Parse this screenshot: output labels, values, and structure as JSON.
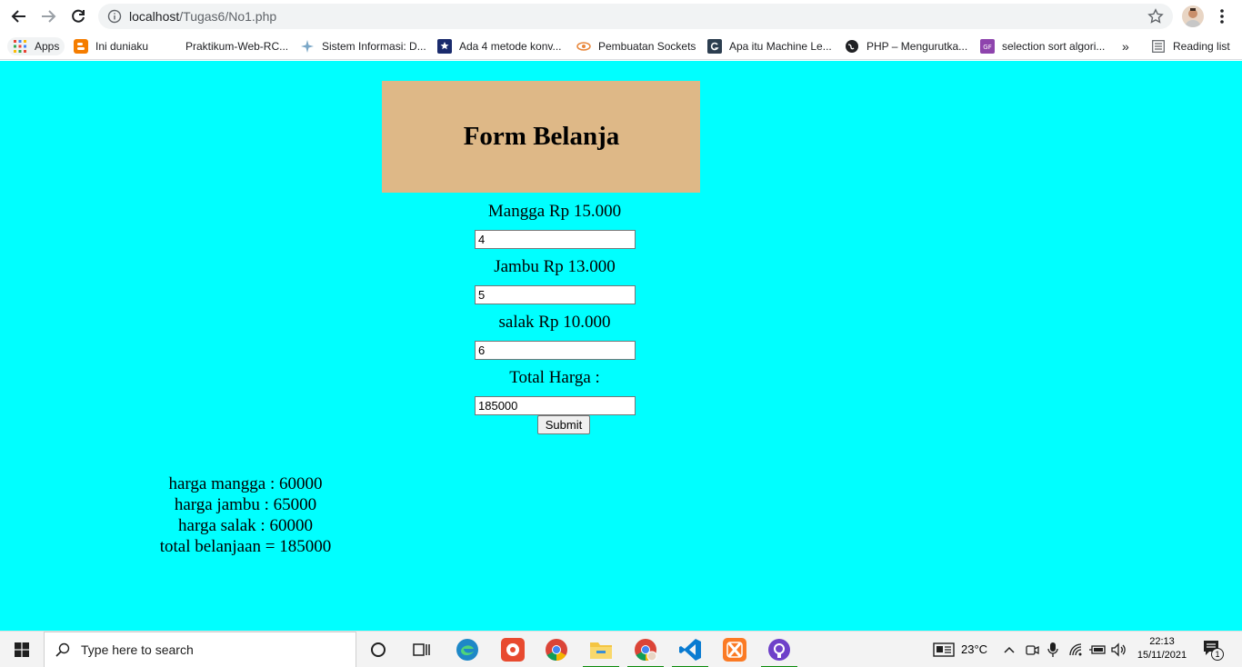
{
  "browser": {
    "url_host": "localhost",
    "url_path": "/Tugas6/No1.php",
    "bookmarks": [
      {
        "label": "Apps"
      },
      {
        "label": "Ini duniaku"
      },
      {
        "label": "Praktikum-Web-RC..."
      },
      {
        "label": "Sistem Informasi: D..."
      },
      {
        "label": "Ada 4 metode konv..."
      },
      {
        "label": "Pembuatan Sockets"
      },
      {
        "label": "Apa itu Machine Le..."
      },
      {
        "label": "PHP – Mengurutka..."
      },
      {
        "label": "selection sort algori..."
      }
    ],
    "more_label": "»",
    "reading_list": "Reading list"
  },
  "form": {
    "title": "Form Belanja",
    "items": [
      {
        "label": "Mangga Rp 15.000",
        "value": "4"
      },
      {
        "label": "Jambu Rp 13.000",
        "value": "5"
      },
      {
        "label": "salak Rp 10.000",
        "value": "6"
      }
    ],
    "total_label": "Total Harga :",
    "total_value": "185000",
    "submit_label": "Submit"
  },
  "result": {
    "lines": [
      "harga mangga : 60000",
      "harga jambu : 65000",
      "harga salak : 60000",
      "total belanjaan = 185000"
    ]
  },
  "taskbar": {
    "search_placeholder": "Type here to search",
    "weather": "23°C",
    "time": "22:13",
    "date": "15/11/2021",
    "notification_count": "1"
  },
  "colors": {
    "page_bg": "#00ffff",
    "title_bg": "#deb887"
  }
}
